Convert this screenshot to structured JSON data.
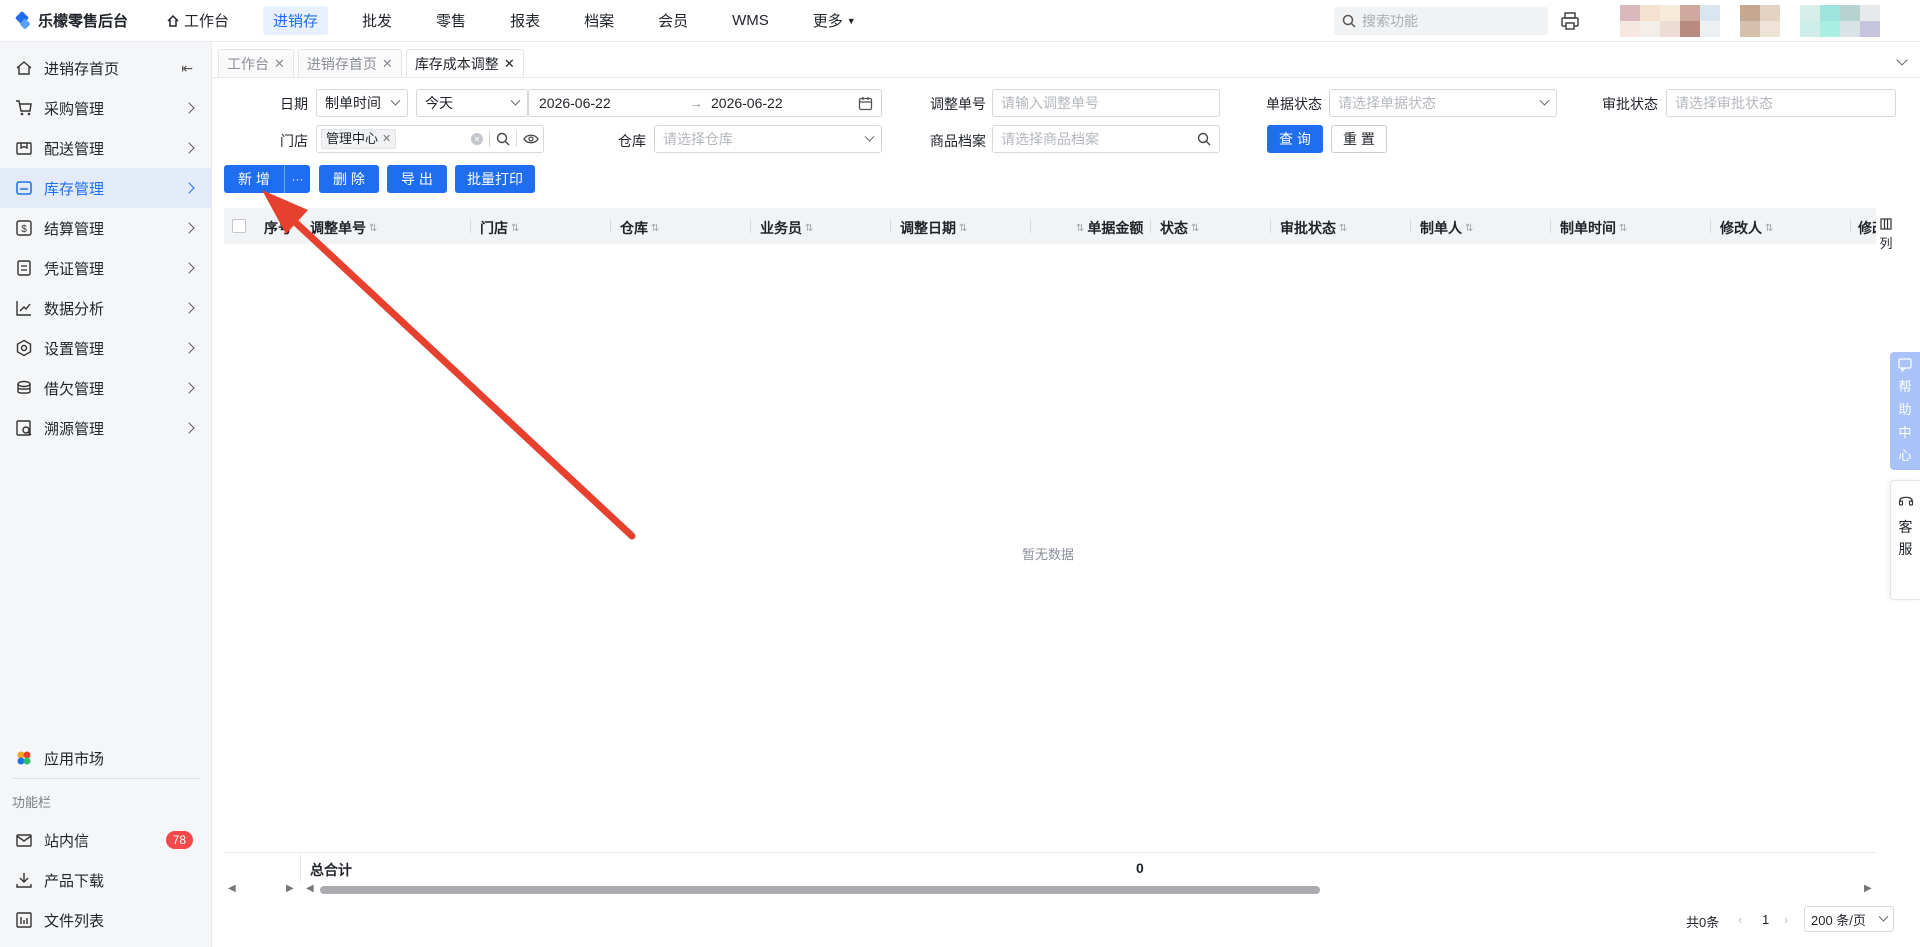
{
  "app": {
    "title": "乐檬零售后台"
  },
  "topnav": [
    {
      "label": "工作台",
      "icon": "home-icon",
      "active": false
    },
    {
      "label": "进销存",
      "active": true
    },
    {
      "label": "批发",
      "active": false
    },
    {
      "label": "零售",
      "active": false
    },
    {
      "label": "报表",
      "active": false
    },
    {
      "label": "档案",
      "active": false
    },
    {
      "label": "会员",
      "active": false
    },
    {
      "label": "WMS",
      "active": false
    },
    {
      "label": "更多",
      "active": false
    }
  ],
  "search": {
    "placeholder": "搜索功能"
  },
  "sidebar": {
    "items": [
      {
        "label": "进销存首页",
        "icon": "home-icon"
      },
      {
        "label": "采购管理",
        "icon": "cart-icon"
      },
      {
        "label": "配送管理",
        "icon": "delivery-icon"
      },
      {
        "label": "库存管理",
        "icon": "inventory-icon",
        "active": true
      },
      {
        "label": "结算管理",
        "icon": "settlement-icon"
      },
      {
        "label": "凭证管理",
        "icon": "voucher-icon"
      },
      {
        "label": "数据分析",
        "icon": "chart-icon"
      },
      {
        "label": "设置管理",
        "icon": "settings-icon"
      },
      {
        "label": "借欠管理",
        "icon": "debt-icon"
      },
      {
        "label": "溯源管理",
        "icon": "trace-icon"
      }
    ],
    "app_market": "应用市场",
    "section_title": "功能栏",
    "bottom_items": [
      {
        "label": "站内信",
        "badge": "78"
      },
      {
        "label": "产品下载"
      },
      {
        "label": "文件列表"
      }
    ]
  },
  "tabs": [
    {
      "label": "工作台",
      "active": false
    },
    {
      "label": "进销存首页",
      "active": false
    },
    {
      "label": "库存成本调整",
      "active": true
    }
  ],
  "filters": {
    "date_label": "日期",
    "date_type": "制单时间",
    "date_range": "今天",
    "date_start": "2026-06-22",
    "date_sep": "→",
    "date_end": "2026-06-22",
    "adjust_no_label": "调整单号",
    "adjust_no_placeholder": "请输入调整单号",
    "doc_status_label": "单据状态",
    "doc_status_placeholder": "请选择单据状态",
    "approve_status_label": "审批状态",
    "approve_status_placeholder": "请选择审批状态",
    "store_label": "门店",
    "store_tag": "管理中心",
    "warehouse_label": "仓库",
    "warehouse_placeholder": "请选择仓库",
    "goods_label": "商品档案",
    "goods_placeholder": "请选择商品档案",
    "query_btn": "查 询",
    "reset_btn": "重 置"
  },
  "actions": {
    "add": "新 增",
    "more": "···",
    "delete": "删 除",
    "export": "导 出",
    "batch_print": "批量打印"
  },
  "table": {
    "columns": [
      "序号",
      "调整单号",
      "门店",
      "仓库",
      "业务员",
      "调整日期",
      "单据金额",
      "状态",
      "审批状态",
      "制单人",
      "制单时间",
      "修改人",
      "修改"
    ],
    "empty_text": "暂无数据",
    "total_label": "总合计",
    "total_amount": "0",
    "column_setting": "列"
  },
  "pagination": {
    "total": "共0条",
    "page": "1",
    "page_size": "200 条/页"
  },
  "float": {
    "help": [
      "帮",
      "助",
      "中",
      "心"
    ],
    "service": [
      "客",
      "服"
    ]
  },
  "colors": {
    "primary": "#1f6ef0",
    "annotation_arrow": "#e8402f",
    "badge": "#f5484a"
  }
}
